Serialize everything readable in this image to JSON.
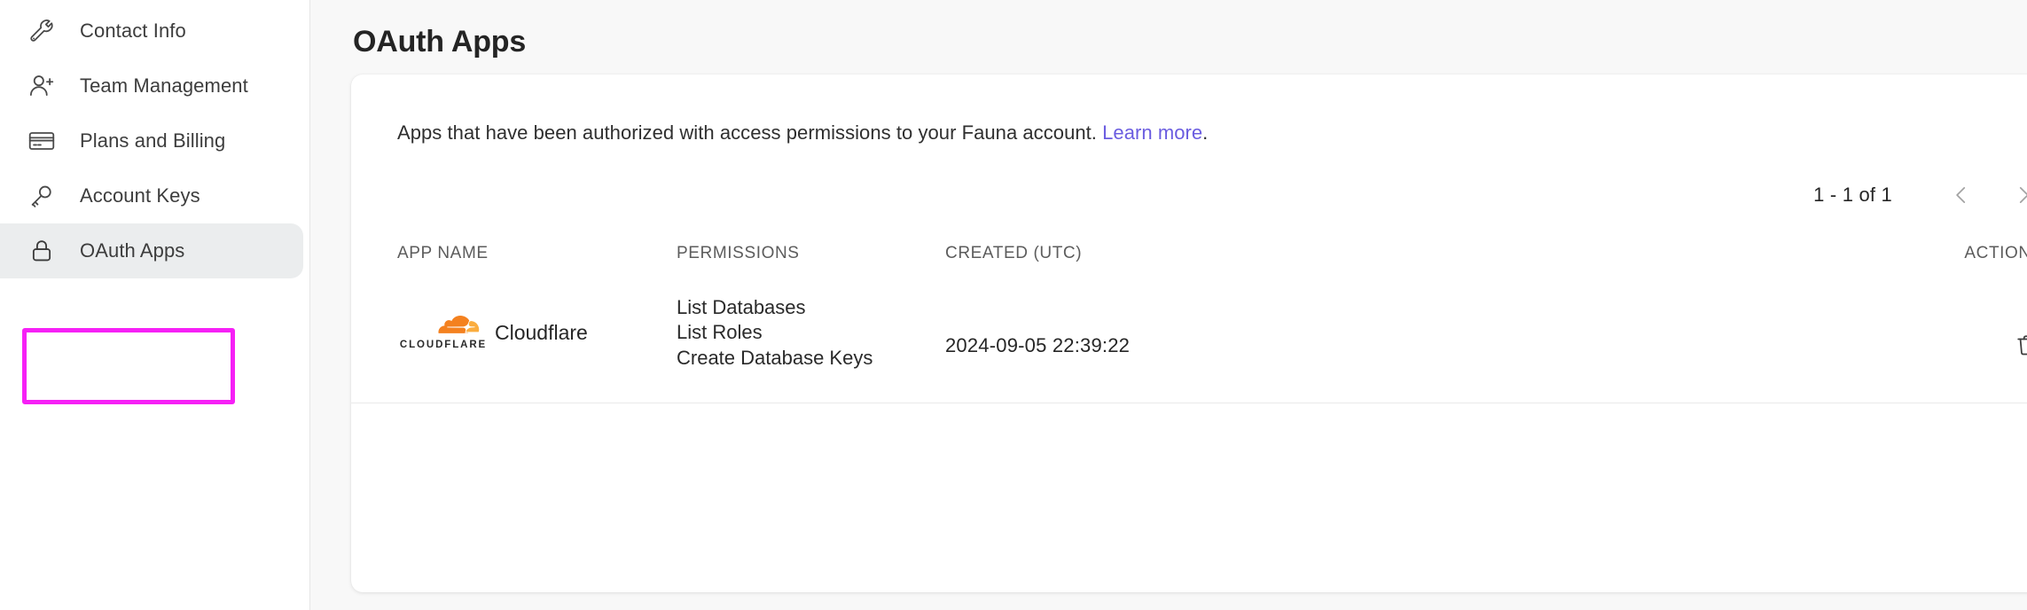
{
  "sidebar": {
    "items": [
      {
        "label": "Contact Info",
        "icon": "wrench-icon",
        "active": false
      },
      {
        "label": "Team Management",
        "icon": "user-plus-icon",
        "active": false
      },
      {
        "label": "Plans and Billing",
        "icon": "credit-card-icon",
        "active": false
      },
      {
        "label": "Account Keys",
        "icon": "key-icon",
        "active": false
      },
      {
        "label": "OAuth Apps",
        "icon": "lock-icon",
        "active": true
      }
    ],
    "annotation_color": "#F620F6"
  },
  "main": {
    "page_title": "OAuth Apps",
    "card": {
      "description_text": "Apps that have been authorized with access permissions to your Fauna account. ",
      "description_link": "Learn more",
      "description_suffix": ".",
      "link_color": "#6A5CE0",
      "pagination": {
        "count_label": "1 - 1 of 1",
        "prev_icon": "chevron-left-icon",
        "next_icon": "chevron-right-icon"
      },
      "table": {
        "headers": {
          "app_name": "APP NAME",
          "permissions": "PERMISSIONS",
          "created": "CREATED (UTC)",
          "actions": "ACTIONS"
        },
        "rows": [
          {
            "logo_wordmark": "CLOUDFLARE",
            "logo_color": "#F08222",
            "app_name": "Cloudflare",
            "permissions": [
              "List Databases",
              "List Roles",
              "Create Database Keys"
            ],
            "created": "2024-09-05 22:39:22",
            "action_icon": "trash-icon"
          }
        ]
      }
    }
  }
}
